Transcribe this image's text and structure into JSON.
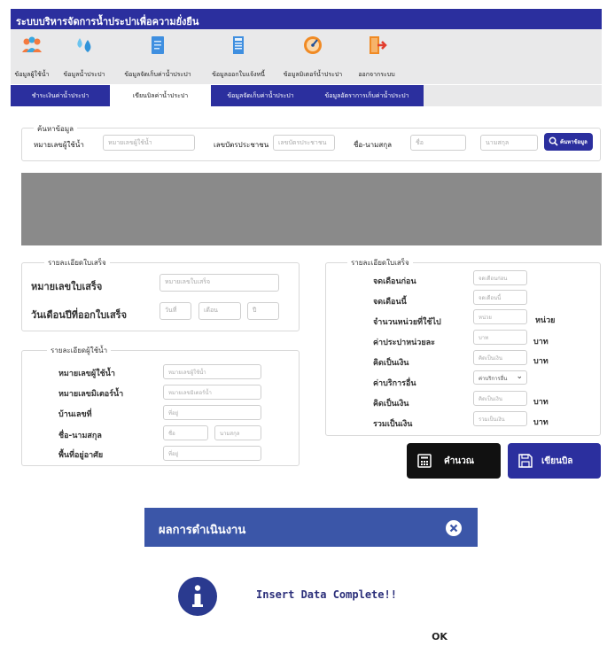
{
  "app": {
    "title": "ระบบบริหารจัดการน้ำประปาเพื่อความยั่งยืน"
  },
  "toolbar": {
    "items": [
      {
        "label": "ข้อมูลผู้ใช้น้ำ",
        "icon": "users-icon"
      },
      {
        "label": "ข้อมูลน้ำประปา",
        "icon": "water-drops-icon"
      },
      {
        "label": "ข้อมูลจัดเก็บค่าน้ำประปา",
        "icon": "document-icon"
      },
      {
        "label": "ข้อมูลออกใบแจ้งหนี้",
        "icon": "invoice-icon"
      },
      {
        "label": "ข้อมูลมิเตอร์น้ำประปา",
        "icon": "meter-icon"
      },
      {
        "label": "ออกจากระบบ",
        "icon": "logout-door-icon"
      }
    ]
  },
  "tabs": [
    {
      "label": "ชำระเงินค่าน้ำประปา"
    },
    {
      "label": "เขียนบิลค่าน้ำประปา"
    },
    {
      "label": "ข้อมูลจัดเก็บค่าน้ำประปา"
    },
    {
      "label": "ข้อมูลอัตราการเก็บค่าน้ำประปา"
    }
  ],
  "search": {
    "legend": "ค้นหาข้อมูล",
    "user_id_label": "หมายเลขผู้ใช้น้ำ",
    "user_id_placeholder": "หมายเลขผู้ใช้น้ำ",
    "citizen_id_label": "เลขบัตรประชาชน",
    "citizen_id_placeholder": "เลขบัตรประชาชน",
    "name_label": "ชื่อ-นามสกุล",
    "first_name_placeholder": "ชื่อ",
    "last_name_placeholder": "นามสกุล",
    "button_label": "ค้นหาข้อมูล"
  },
  "receipt_left": {
    "legend": "รายละเอียดใบเสร็จ",
    "receipt_no_label": "หมายเลขใบเสร็จ",
    "receipt_no_placeholder": "หมายเลขใบเสร็จ",
    "issue_date_label": "วันเดือนปีที่ออกใบเสร็จ",
    "day_placeholder": "วันที่",
    "month_placeholder": "เดือน",
    "year_placeholder": "ปี"
  },
  "user_details": {
    "legend": "รายละเอียดผู้ใช้น้ำ",
    "user_id_label": "หมายเลขผู้ใช้น้ำ",
    "user_id_placeholder": "หมายเลขผู้ใช้น้ำ",
    "meter_no_label": "หมายเลขมิเตอร์น้ำ",
    "meter_no_placeholder": "หมายเลขมิเตอร์น้ำ",
    "house_no_label": "บ้านเลขที่",
    "house_no_placeholder": "ที่อยู่",
    "name_label": "ชื่อ-นามสกุล",
    "first_name_placeholder": "ชื่อ",
    "last_name_placeholder": "นามสกุล",
    "area_label": "พื้นที่อยู่อาศัย",
    "area_placeholder": "ที่อยู่"
  },
  "receipt_right": {
    "legend": "รายละเอียดใบเสร็จ",
    "prev_reading_label": "จดเดือนก่อน",
    "prev_reading_placeholder": "จดเดือนก่อน",
    "curr_reading_label": "จดเดือนนี้",
    "curr_reading_placeholder": "จดเดือนนี้",
    "units_used_label": "จำนวนหน่วยที่ใช้ไป",
    "units_used_placeholder": "หน่วย",
    "units_used_unit": "หน่วย",
    "rate_label": "ค่าประปาหน่วยละ",
    "rate_placeholder": "บาท",
    "rate_unit": "บาท",
    "amount_label": "คิดเป็นเงิน",
    "amount_placeholder": "คิดเป็นเงิน",
    "amount_unit": "บาท",
    "other_service_label": "ค่าบริการอื่น",
    "other_service_value": "ค่าบริการอื่น",
    "other_amount_label": "คิดเป็นเงิน",
    "other_amount_placeholder": "คิดเป็นเงิน",
    "other_amount_unit": "บาท",
    "total_label": "รวมเป็นเงิน",
    "total_placeholder": "รวมเป็นเงิน",
    "total_unit": "บาท"
  },
  "actions": {
    "calculate_label": "คำนวณ",
    "write_bill_label": "เขียนบิล"
  },
  "dialog": {
    "title": "ผลการดำเนินงาน",
    "message": "Insert Data Complete!!",
    "ok_label": "OK"
  },
  "colors": {
    "primary": "#2b2f9e",
    "dialog_header": "#3b56a8",
    "info_icon": "#2a3a8f",
    "calc_button": "#111111"
  }
}
